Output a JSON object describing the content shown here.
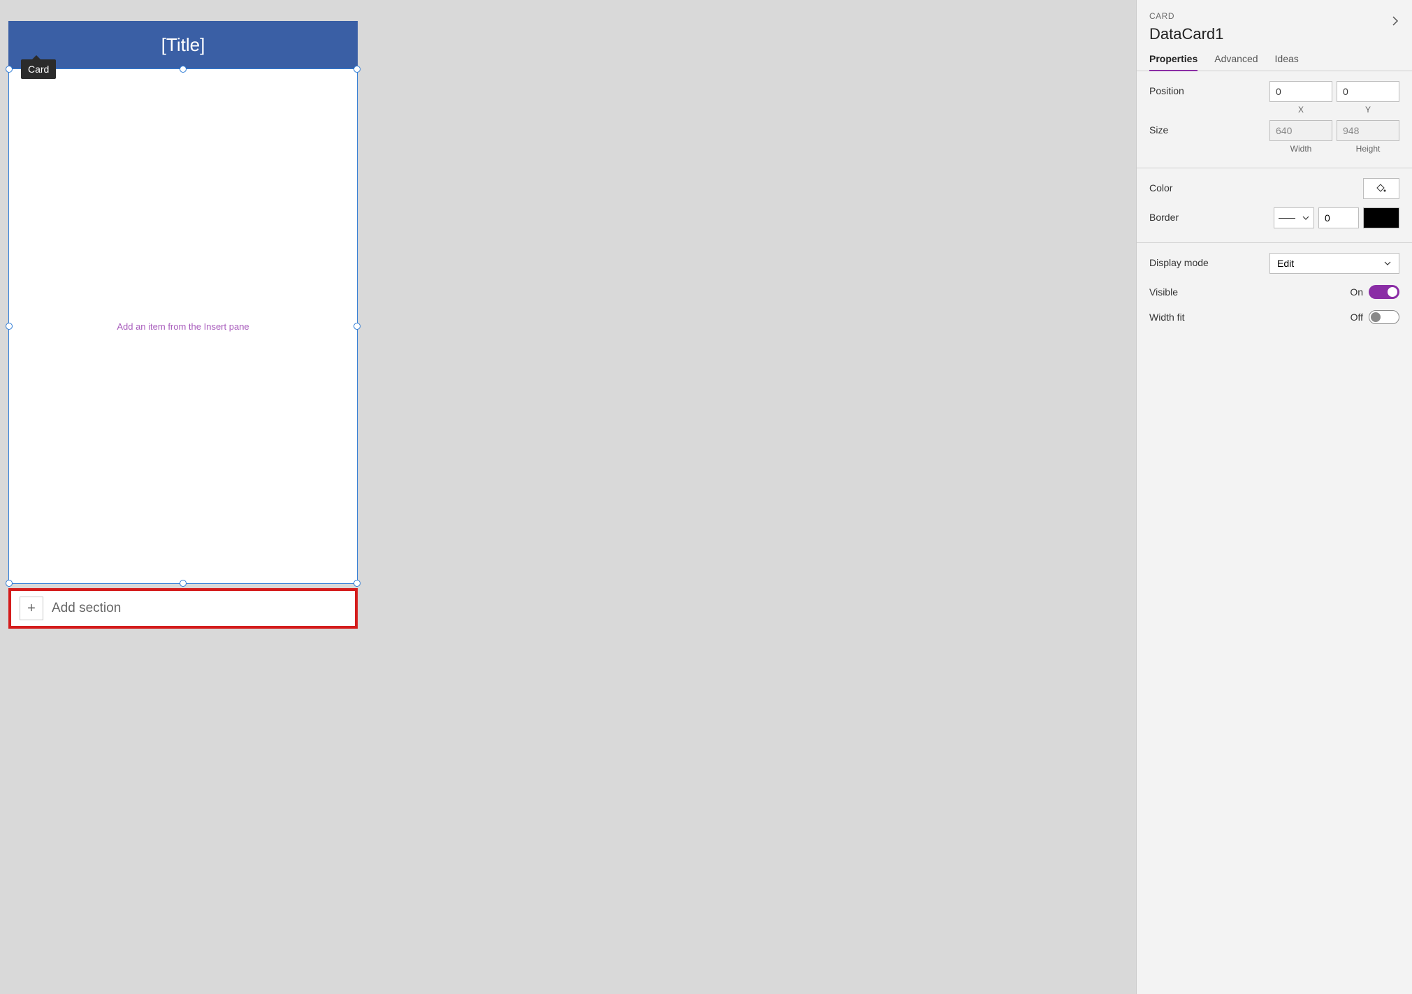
{
  "canvas": {
    "tooltip_label": "Card",
    "title_placeholder": "[Title]",
    "body_placeholder": "Add an item from the Insert pane",
    "add_section_label": "Add section"
  },
  "panel": {
    "type_label": "CARD",
    "object_name": "DataCard1",
    "tabs": {
      "properties": "Properties",
      "advanced": "Advanced",
      "ideas": "Ideas"
    },
    "position": {
      "label": "Position",
      "x": "0",
      "y": "0",
      "x_label": "X",
      "y_label": "Y"
    },
    "size": {
      "label": "Size",
      "width": "640",
      "height": "948",
      "width_label": "Width",
      "height_label": "Height"
    },
    "color": {
      "label": "Color"
    },
    "border": {
      "label": "Border",
      "width_value": "0",
      "color": "#000000"
    },
    "display_mode": {
      "label": "Display mode",
      "value": "Edit"
    },
    "visible": {
      "label": "Visible",
      "state": "On"
    },
    "width_fit": {
      "label": "Width fit",
      "state": "Off"
    }
  }
}
